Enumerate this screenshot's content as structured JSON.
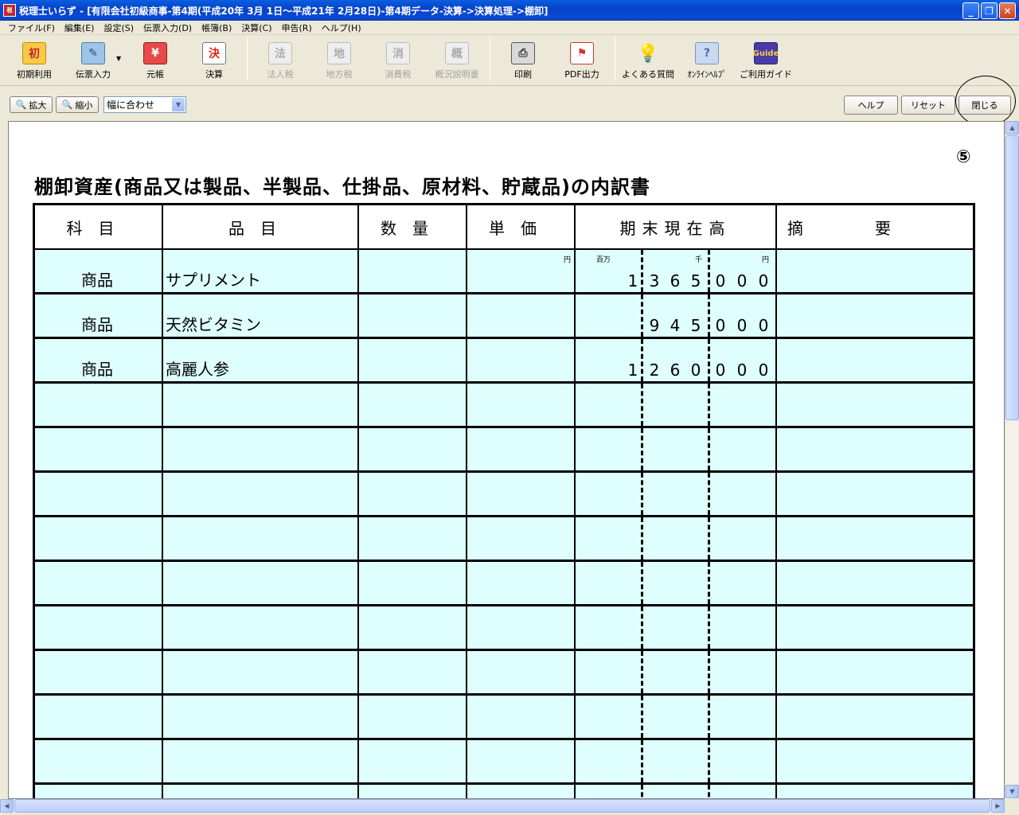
{
  "window": {
    "title": "税理士いらず - [有限会社初級商事-第4期(平成20年 3月 1日～平成21年 2月28日)-第4期データ-決算->決算処理->棚卸]",
    "app_icon_text": "税"
  },
  "menu": [
    "ファイル(F)",
    "編集(E)",
    "設定(S)",
    "伝票入力(D)",
    "帳簿(B)",
    "決算(C)",
    "申告(R)",
    "ヘルプ(H)"
  ],
  "toolbar": {
    "initial": "初期利用",
    "slip": "伝票入力",
    "ledger": "元帳",
    "settlement": "決算",
    "corp_tax": "法人税",
    "local_tax": "地方税",
    "consumption_tax": "消費税",
    "overview": "概況説明書",
    "print": "印刷",
    "pdf": "PDF出力",
    "faq": "よくある質問",
    "online_help": "ｵﾝﾗｲﾝﾍﾙﾌﾟ",
    "guide": "ご利用ガイド",
    "guide_badge": "Guide"
  },
  "zoom": {
    "zoom_in": "拡大",
    "zoom_out": "縮小",
    "fit_select": "幅に合わせ",
    "help": "ヘルプ",
    "reset": "リセット",
    "close": "閉じる"
  },
  "document": {
    "page_number": "⑤",
    "title": "棚卸資産(商品又は製品、半製品、仕掛品、原材料、貯蔵品)の内訳書",
    "headers": {
      "subject": "科目",
      "item": "品目",
      "quantity": "数量",
      "unit_price": "単価",
      "ending_balance": "期末現在高",
      "remarks": "摘要"
    },
    "units": {
      "yen_price": "円",
      "million": "百万",
      "thousand": "千",
      "yen": "円"
    },
    "rows": [
      {
        "subject": "商品",
        "item": "サプリメント",
        "m": "1",
        "t": [
          "3",
          "6",
          "5"
        ],
        "y": [
          "0",
          "0",
          "0"
        ]
      },
      {
        "subject": "商品",
        "item": "天然ビタミン",
        "m": "",
        "t": [
          "9",
          "4",
          "5"
        ],
        "y": [
          "0",
          "0",
          "0"
        ]
      },
      {
        "subject": "商品",
        "item": "高麗人参",
        "m": "1",
        "t": [
          "2",
          "6",
          "0"
        ],
        "y": [
          "0",
          "0",
          "0"
        ]
      }
    ]
  }
}
